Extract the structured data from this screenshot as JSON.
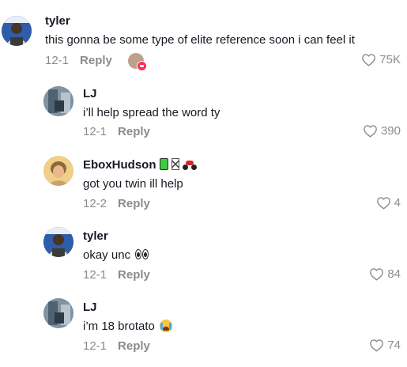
{
  "comments": [
    {
      "username": "tyler",
      "text": "this gonna be some type of elite reference soon i can feel it",
      "date": "12-1",
      "reply_label": "Reply",
      "likes": "75K",
      "avatar_icon": "tyler-avatar"
    },
    {
      "username": "LJ",
      "text": "i’ll help spread the word ty",
      "date": "12-1",
      "reply_label": "Reply",
      "likes": "390",
      "avatar_icon": "lj-avatar"
    },
    {
      "username": "EboxHudson",
      "text": "got you twin ill help",
      "date": "12-2",
      "reply_label": "Reply",
      "likes": "4",
      "avatar_icon": "ebox-avatar"
    },
    {
      "username": "tyler",
      "text": "okay unc",
      "date": "12-1",
      "reply_label": "Reply",
      "likes": "84",
      "avatar_icon": "tyler-avatar"
    },
    {
      "username": "LJ",
      "text": "i’m 18 brotato",
      "date": "12-1",
      "reply_label": "Reply",
      "likes": "74",
      "avatar_icon": "lj-avatar"
    }
  ],
  "colors": {
    "text": "#161823",
    "muted": "#8a8b91",
    "tiktok_red": "#fe2c55"
  }
}
